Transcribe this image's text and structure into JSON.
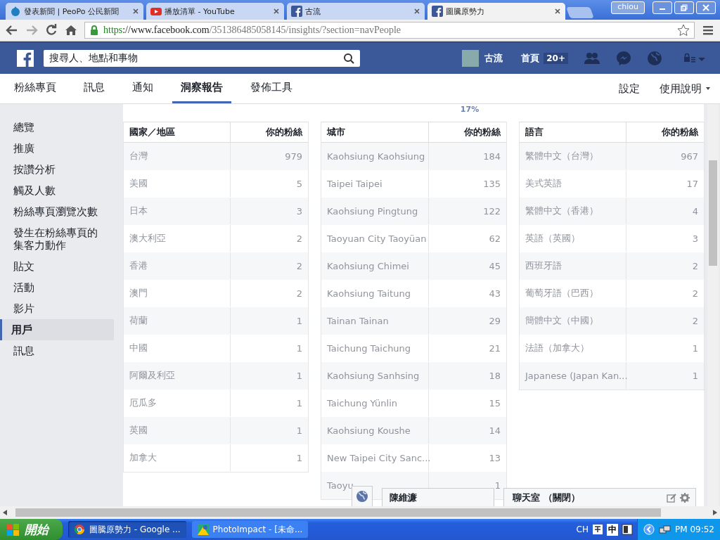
{
  "browser": {
    "tabs": [
      {
        "title": "發表新聞 | PeoPo 公民新聞",
        "selected": false
      },
      {
        "title": "播放清單 - YouTube",
        "selected": false
      },
      {
        "title": "古流",
        "selected": false
      },
      {
        "title": "圖騰原勢力",
        "selected": true
      }
    ],
    "user": "chiou",
    "url": {
      "scheme": "https",
      "host": "://www.facebook.com",
      "path": "/351386485058145/insights/?section=navPeople"
    }
  },
  "header": {
    "search_placeholder": "搜尋人、地點和事物",
    "profile_name": "古流",
    "home": "首頁",
    "home_badge": "20+"
  },
  "page_nav": {
    "tabs": [
      {
        "label": "粉絲專頁",
        "selected": false
      },
      {
        "label": "訊息",
        "selected": false
      },
      {
        "label": "通知",
        "selected": false
      },
      {
        "label": "洞察報告",
        "selected": true
      },
      {
        "label": "發佈工具",
        "selected": false
      }
    ],
    "right": [
      "設定",
      "使用說明"
    ]
  },
  "sidebar": {
    "items": [
      {
        "label": "總覽",
        "selected": false
      },
      {
        "label": "推廣",
        "selected": false
      },
      {
        "label": "按讚分析",
        "selected": false
      },
      {
        "label": "觸及人數",
        "selected": false
      },
      {
        "label": "粉絲專頁瀏覽次數",
        "selected": false
      },
      {
        "label": "發生在粉絲專頁的集客力動作",
        "selected": false
      },
      {
        "label": "貼文",
        "selected": false
      },
      {
        "label": "活動",
        "selected": false
      },
      {
        "label": "影片",
        "selected": false
      },
      {
        "label": "用戶",
        "selected": true
      },
      {
        "label": "訊息",
        "selected": false
      }
    ]
  },
  "chart_percent": "17%",
  "tables": [
    {
      "columns": [
        "國家／地區",
        "你的粉絲"
      ],
      "rows": [
        [
          "台灣",
          "979"
        ],
        [
          "美國",
          "5"
        ],
        [
          "日本",
          "3"
        ],
        [
          "澳大利亞",
          "2"
        ],
        [
          "香港",
          "2"
        ],
        [
          "澳門",
          "2"
        ],
        [
          "荷蘭",
          "1"
        ],
        [
          "中國",
          "1"
        ],
        [
          "阿爾及利亞",
          "1"
        ],
        [
          "厄瓜多",
          "1"
        ],
        [
          "英國",
          "1"
        ],
        [
          "加拿大",
          "1"
        ]
      ]
    },
    {
      "columns": [
        "城市",
        "你的粉絲"
      ],
      "rows": [
        [
          "Kaohsiung Kaohsiung",
          "184"
        ],
        [
          "Taipei Taipei",
          "135"
        ],
        [
          "Kaohsiung Pingtung",
          "122"
        ],
        [
          "Taoyuan City Taoyüan",
          "62"
        ],
        [
          "Kaohsiung Chimei",
          "45"
        ],
        [
          "Kaohsiung Taitung",
          "43"
        ],
        [
          "Tainan Tainan",
          "29"
        ],
        [
          "Taichung Taichung",
          "21"
        ],
        [
          "Kaohsiung Sanhsing",
          "18"
        ],
        [
          "Taichung Yünlin",
          "15"
        ],
        [
          "Kaohsiung Koushe",
          "14"
        ],
        [
          "New Taipei City Sanc...",
          "13"
        ],
        [
          "Taoyu",
          "1"
        ]
      ]
    },
    {
      "columns": [
        "語言",
        "你的粉絲"
      ],
      "rows": [
        [
          "繁體中文（台灣）",
          "967"
        ],
        [
          "美式英語",
          "17"
        ],
        [
          "繁體中文（香港）",
          "4"
        ],
        [
          "英語（英國）",
          "3"
        ],
        [
          "西班牙語",
          "2"
        ],
        [
          "葡萄牙語（巴西）",
          "2"
        ],
        [
          "簡體中文（中國）",
          "2"
        ],
        [
          "法語（加拿大）",
          "1"
        ],
        [
          "Japanese (Japan Kan...",
          "1"
        ]
      ]
    }
  ],
  "chat": {
    "tab_name": "陳維濂",
    "panel_title": "聊天室 （關閉）"
  },
  "taskbar": {
    "start": "開始",
    "tasks": [
      {
        "title": "圖騰原勢力 - Google ...",
        "selected": true
      },
      {
        "title": "PhotoImpact - [未命...",
        "selected": false
      }
    ],
    "tray": [
      "CH",
      "中"
    ],
    "clock": "PM 09:52"
  }
}
